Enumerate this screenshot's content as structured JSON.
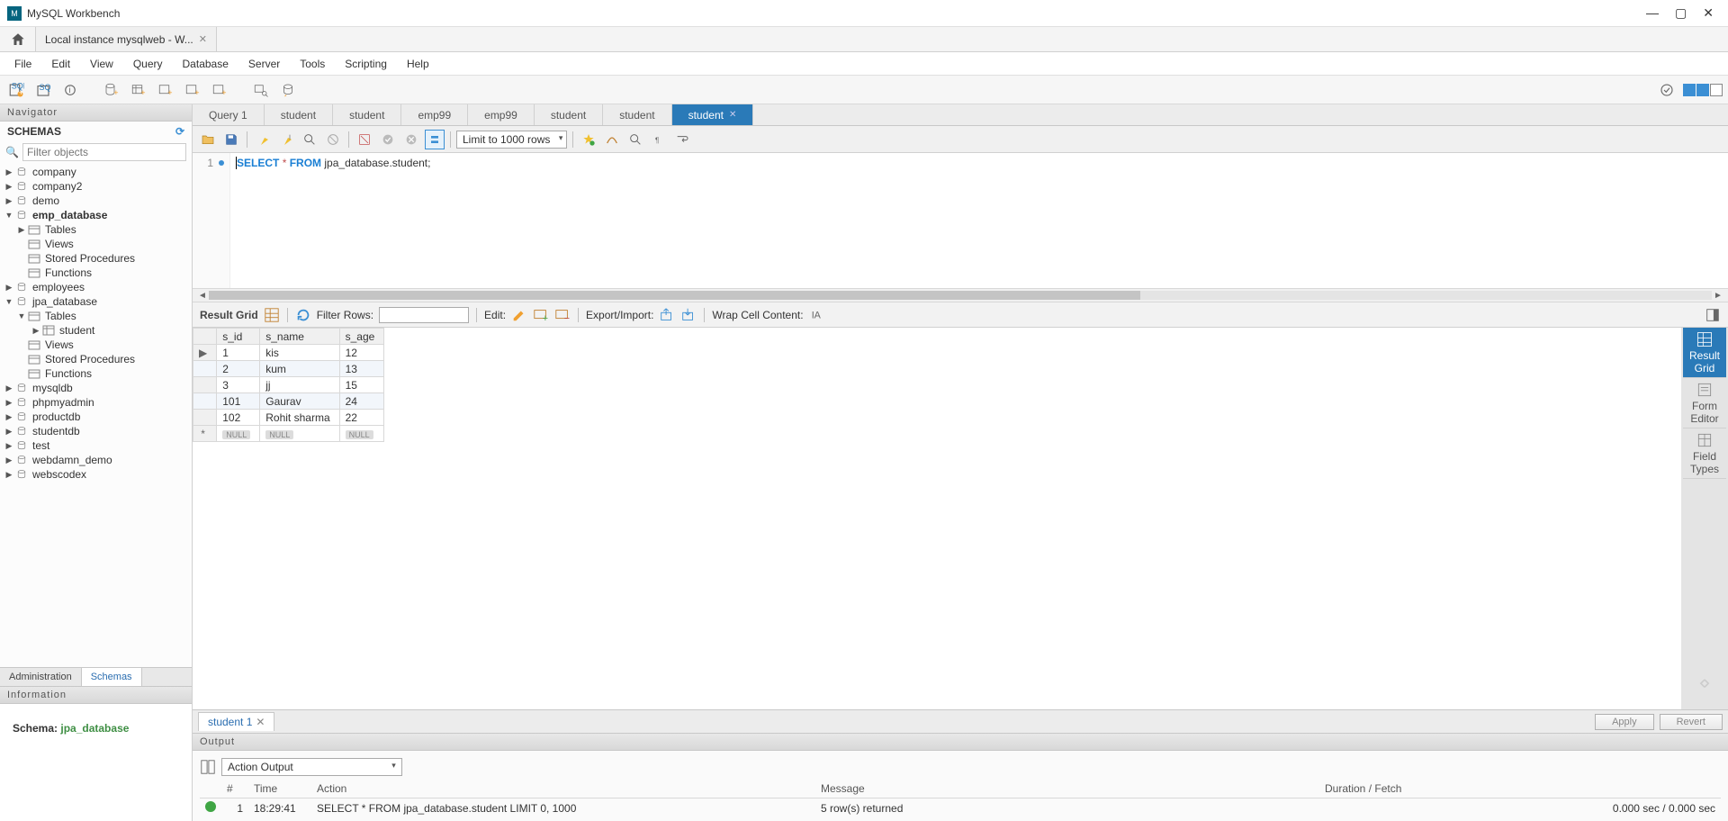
{
  "app": {
    "title": "MySQL Workbench"
  },
  "conn_tab": {
    "label": "Local instance mysqlweb - W..."
  },
  "menus": [
    "File",
    "Edit",
    "View",
    "Query",
    "Database",
    "Server",
    "Tools",
    "Scripting",
    "Help"
  ],
  "navigator": {
    "title": "Navigator",
    "schemas_label": "SCHEMAS",
    "filter_placeholder": "Filter objects",
    "tree": [
      {
        "label": "company",
        "type": "db",
        "indent": 0,
        "arrow": "▶"
      },
      {
        "label": "company2",
        "type": "db",
        "indent": 0,
        "arrow": "▶"
      },
      {
        "label": "demo",
        "type": "db",
        "indent": 0,
        "arrow": "▶"
      },
      {
        "label": "emp_database",
        "type": "db",
        "indent": 0,
        "arrow": "▼",
        "bold": true
      },
      {
        "label": "Tables",
        "type": "folder",
        "indent": 1,
        "arrow": "▶"
      },
      {
        "label": "Views",
        "type": "folder",
        "indent": 1,
        "arrow": ""
      },
      {
        "label": "Stored Procedures",
        "type": "folder",
        "indent": 1,
        "arrow": ""
      },
      {
        "label": "Functions",
        "type": "folder",
        "indent": 1,
        "arrow": ""
      },
      {
        "label": "employees",
        "type": "db",
        "indent": 0,
        "arrow": "▶"
      },
      {
        "label": "jpa_database",
        "type": "db",
        "indent": 0,
        "arrow": "▼"
      },
      {
        "label": "Tables",
        "type": "folder",
        "indent": 1,
        "arrow": "▼"
      },
      {
        "label": "student",
        "type": "table",
        "indent": 2,
        "arrow": "▶"
      },
      {
        "label": "Views",
        "type": "folder",
        "indent": 1,
        "arrow": ""
      },
      {
        "label": "Stored Procedures",
        "type": "folder",
        "indent": 1,
        "arrow": ""
      },
      {
        "label": "Functions",
        "type": "folder",
        "indent": 1,
        "arrow": ""
      },
      {
        "label": "mysqldb",
        "type": "db",
        "indent": 0,
        "arrow": "▶"
      },
      {
        "label": "phpmyadmin",
        "type": "db",
        "indent": 0,
        "arrow": "▶"
      },
      {
        "label": "productdb",
        "type": "db",
        "indent": 0,
        "arrow": "▶"
      },
      {
        "label": "studentdb",
        "type": "db",
        "indent": 0,
        "arrow": "▶"
      },
      {
        "label": "test",
        "type": "db",
        "indent": 0,
        "arrow": "▶"
      },
      {
        "label": "webdamn_demo",
        "type": "db",
        "indent": 0,
        "arrow": "▶"
      },
      {
        "label": "webscodex",
        "type": "db",
        "indent": 0,
        "arrow": "▶"
      }
    ],
    "tabs": {
      "admin": "Administration",
      "schemas": "Schemas"
    }
  },
  "information": {
    "title": "Information",
    "schema_label": "Schema:",
    "schema_name": "jpa_database"
  },
  "query_tabs": [
    "Query 1",
    "student",
    "student",
    "emp99",
    "emp99",
    "student",
    "student",
    "student"
  ],
  "active_query_tab_index": 7,
  "query_toolbar": {
    "limit_label": "Limit to 1000 rows"
  },
  "sql": {
    "line_no": "1",
    "kw_select": "SELECT",
    "star": "*",
    "kw_from": "FROM",
    "rest": "jpa_database.student;"
  },
  "result_toolbar": {
    "grid_label": "Result Grid",
    "filter_label": "Filter Rows:",
    "edit_label": "Edit:",
    "export_label": "Export/Import:",
    "wrap_label": "Wrap Cell Content:"
  },
  "result": {
    "columns": [
      "s_id",
      "s_name",
      "s_age"
    ],
    "rows": [
      {
        "s_id": "1",
        "s_name": "kis",
        "s_age": "12"
      },
      {
        "s_id": "2",
        "s_name": "kum",
        "s_age": "13"
      },
      {
        "s_id": "3",
        "s_name": "jj",
        "s_age": "15"
      },
      {
        "s_id": "101",
        "s_name": "Gaurav",
        "s_age": "24"
      },
      {
        "s_id": "102",
        "s_name": "Rohit sharma",
        "s_age": "22"
      }
    ],
    "null_label": "NULL"
  },
  "side_tabs": {
    "grid": "Result Grid",
    "form": "Form Editor",
    "types": "Field Types"
  },
  "result_footer": {
    "tab_label": "student 1",
    "apply": "Apply",
    "revert": "Revert"
  },
  "output": {
    "title": "Output",
    "select_label": "Action Output",
    "headers": {
      "num": "#",
      "time": "Time",
      "action": "Action",
      "message": "Message",
      "duration": "Duration / Fetch"
    },
    "row": {
      "num": "1",
      "time": "18:29:41",
      "action": "SELECT * FROM jpa_database.student LIMIT 0, 1000",
      "message": "5 row(s) returned",
      "duration": "0.000 sec / 0.000 sec"
    }
  }
}
